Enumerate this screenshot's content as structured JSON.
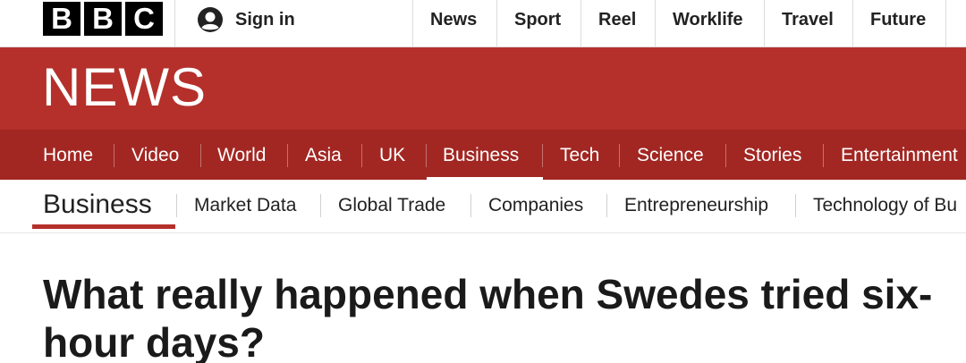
{
  "topbar": {
    "logo": [
      "B",
      "B",
      "C"
    ],
    "signin_label": "Sign in",
    "links": [
      "News",
      "Sport",
      "Reel",
      "Worklife",
      "Travel",
      "Future"
    ]
  },
  "banner": {
    "wordmark": "NEWS"
  },
  "mainnav": {
    "items": [
      "Home",
      "Video",
      "World",
      "Asia",
      "UK",
      "Business",
      "Tech",
      "Science",
      "Stories",
      "Entertainment"
    ],
    "active": "Business"
  },
  "subnav": {
    "section_title": "Business",
    "items": [
      "Market Data",
      "Global Trade",
      "Companies",
      "Entrepreneurship",
      "Technology of Bu"
    ]
  },
  "article": {
    "headline": "What really happened when Swedes tried six-hour days?"
  },
  "colors": {
    "brand_red": "#b5302b",
    "nav_red": "#a22722"
  }
}
